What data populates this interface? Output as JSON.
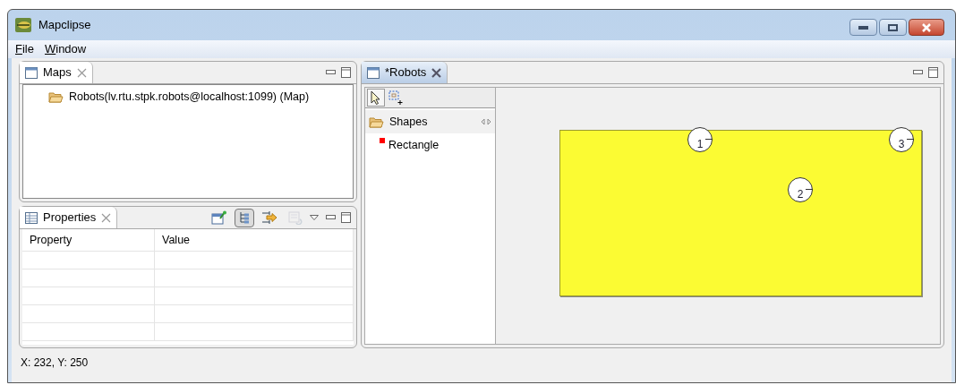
{
  "window": {
    "title": "Mapclipse"
  },
  "menu": [
    "File",
    "Window"
  ],
  "maps_view": {
    "tab": {
      "label": "Maps",
      "selected": false
    },
    "items": [
      "Robots(lv.rtu.stpk.robots@localhost:1099) (Map)"
    ]
  },
  "properties_view": {
    "tab": {
      "label": "Properties",
      "selected": false
    },
    "toolbar": [
      {
        "pressed": false,
        "disabled": false
      },
      {
        "pressed": true,
        "disabled": false
      },
      {
        "pressed": false,
        "disabled": false
      },
      {
        "pressed": false,
        "disabled": true
      }
    ],
    "columns": [
      "Property",
      "Value"
    ]
  },
  "editor": {
    "tab": {
      "label": "*Robots",
      "selected": true
    },
    "palette": {
      "tools": [
        {
          "kind": "select",
          "selected": true
        },
        {
          "kind": "marquee",
          "selected": false
        }
      ],
      "drawer": {
        "label": "Shapes",
        "entries": [
          {
            "label": "Rectangle",
            "color": "#ff0000"
          }
        ]
      }
    },
    "robots": [
      "1",
      "2",
      "3"
    ]
  },
  "status_bar": "X: 232, Y: 250"
}
